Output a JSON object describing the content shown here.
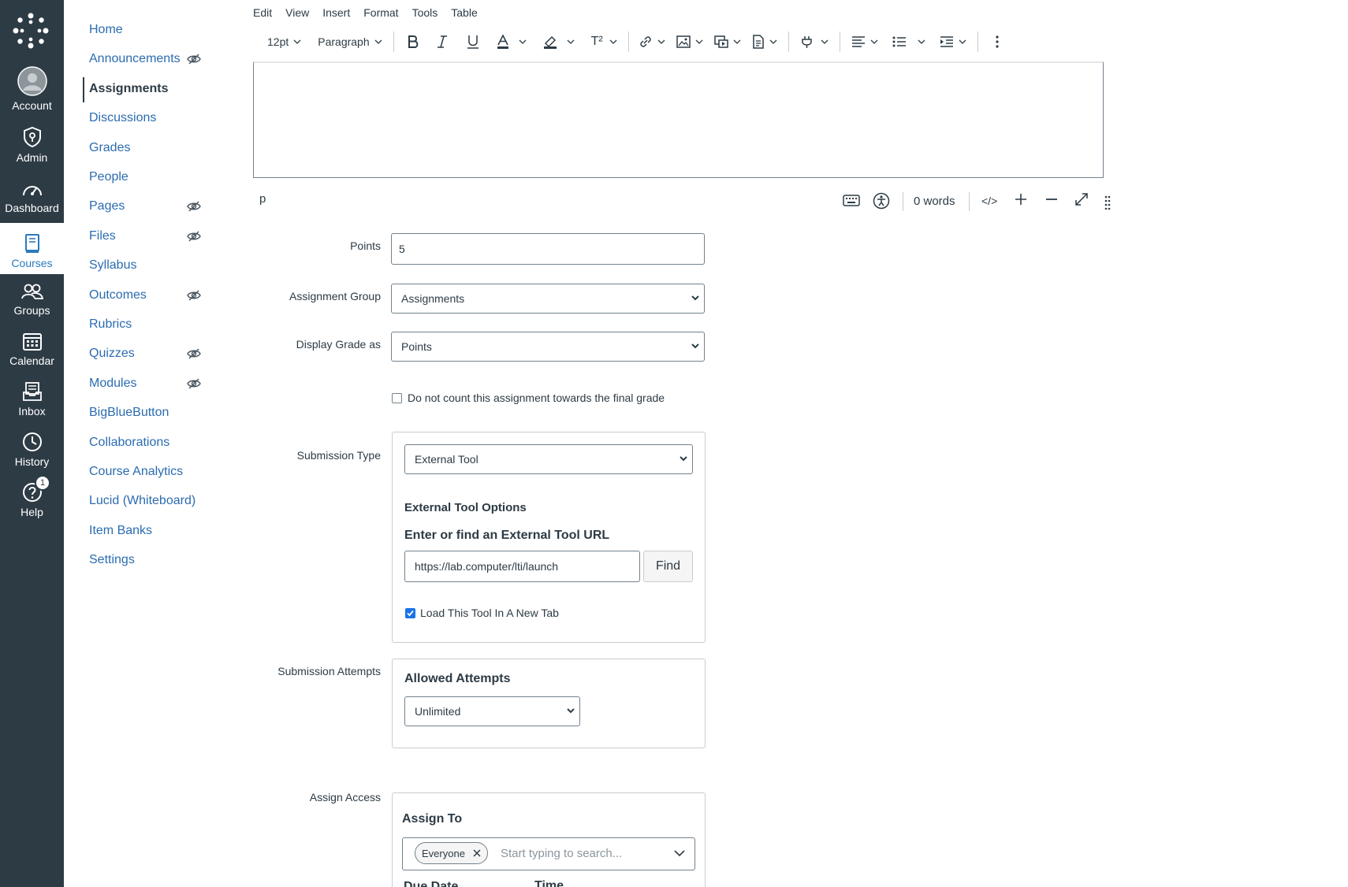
{
  "global_nav": {
    "items": [
      {
        "label": "Account",
        "icon": "account-icon"
      },
      {
        "label": "Admin",
        "icon": "admin-shield-icon"
      },
      {
        "label": "Dashboard",
        "icon": "dashboard-icon"
      },
      {
        "label": "Courses",
        "icon": "courses-book-icon"
      },
      {
        "label": "Groups",
        "icon": "groups-icon"
      },
      {
        "label": "Calendar",
        "icon": "calendar-icon"
      },
      {
        "label": "Inbox",
        "icon": "inbox-icon"
      },
      {
        "label": "History",
        "icon": "history-clock-icon"
      },
      {
        "label": "Help",
        "icon": "help-icon"
      }
    ],
    "active": "Courses",
    "help_badge": "1",
    "colors": {
      "background": "#2d3b45",
      "active_text": "#2b7abc"
    }
  },
  "course_nav": {
    "items": [
      {
        "label": "Home",
        "hidden": false
      },
      {
        "label": "Announcements",
        "hidden": true
      },
      {
        "label": "Assignments",
        "hidden": false
      },
      {
        "label": "Discussions",
        "hidden": false
      },
      {
        "label": "Grades",
        "hidden": false
      },
      {
        "label": "People",
        "hidden": false
      },
      {
        "label": "Pages",
        "hidden": true
      },
      {
        "label": "Files",
        "hidden": true
      },
      {
        "label": "Syllabus",
        "hidden": false
      },
      {
        "label": "Outcomes",
        "hidden": true
      },
      {
        "label": "Rubrics",
        "hidden": false
      },
      {
        "label": "Quizzes",
        "hidden": true
      },
      {
        "label": "Modules",
        "hidden": true
      },
      {
        "label": "BigBlueButton",
        "hidden": false
      },
      {
        "label": "Collaborations",
        "hidden": false
      },
      {
        "label": "Course Analytics",
        "hidden": false
      },
      {
        "label": "Lucid (Whiteboard)",
        "hidden": false
      },
      {
        "label": "Item Banks",
        "hidden": false
      },
      {
        "label": "Settings",
        "hidden": false
      }
    ],
    "active": "Assignments",
    "link_color": "#2b6cb0"
  },
  "editor": {
    "menu": [
      "Edit",
      "View",
      "Insert",
      "Format",
      "Tools",
      "Table"
    ],
    "font_size": "12pt",
    "block_format": "Paragraph",
    "superscript_label": "T²",
    "path": "p",
    "word_count": "0 words",
    "html_toggle": "</>"
  },
  "form": {
    "points_label": "Points",
    "points_value": "5",
    "assignment_group_label": "Assignment Group",
    "assignment_group_value": "Assignments",
    "display_grade_label": "Display Grade as",
    "display_grade_value": "Points",
    "omit_from_final_label": "Do not count this assignment towards the final grade",
    "submission_type_label": "Submission Type",
    "submission_type_value": "External Tool",
    "external_tool_options_heading": "External Tool Options",
    "external_tool_url_heading": "Enter or find an External Tool URL",
    "external_tool_url_value": "https://lab.computer/lti/launch",
    "find_button": "Find",
    "new_tab_label": "Load This Tool In A New Tab",
    "new_tab_checked": true,
    "submission_attempts_label": "Submission Attempts",
    "allowed_attempts_heading": "Allowed Attempts",
    "allowed_attempts_value": "Unlimited",
    "assign_access_label": "Assign Access",
    "assign_to_heading": "Assign To",
    "assign_to_tag": "Everyone",
    "assign_to_placeholder": "Start typing to search...",
    "due_date_label": "Due Date",
    "time_label": "Time"
  }
}
